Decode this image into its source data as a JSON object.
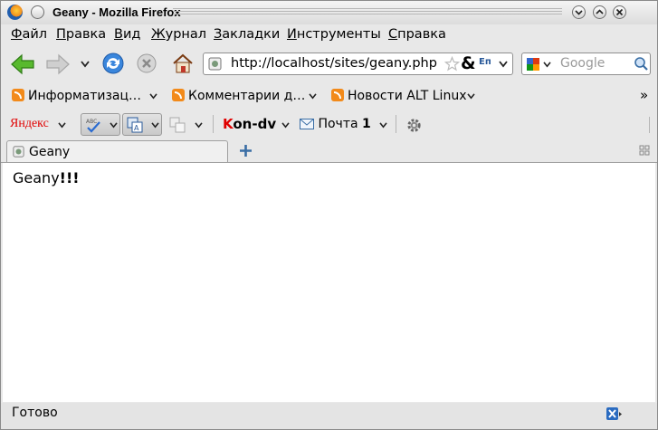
{
  "window": {
    "title": "Geany - Mozilla Firefox"
  },
  "menubar": {
    "items": [
      {
        "label": "Файл",
        "u": "Ф",
        "rest": "айл"
      },
      {
        "label": "Правка",
        "u": "П",
        "rest": "равка"
      },
      {
        "label": "Вид",
        "u": "В",
        "rest": "ид"
      },
      {
        "label": "Журнал",
        "u": "Ж",
        "rest": "урнал"
      },
      {
        "label": "Закладки",
        "u": "З",
        "rest": "акладки"
      },
      {
        "label": "Инструменты",
        "u": "И",
        "rest": "нструменты"
      },
      {
        "label": "Справка",
        "u": "С",
        "rest": "правка"
      }
    ]
  },
  "nav": {
    "url": "http://localhost/sites/geany.php",
    "search_placeholder": "Google",
    "back_icon": "back-arrow-icon",
    "forward_icon": "forward-arrow-icon",
    "reload_icon": "reload-icon",
    "stop_icon": "stop-icon",
    "home_icon": "home-icon"
  },
  "bookmarks": {
    "items": [
      {
        "label": "Информатизац…"
      },
      {
        "label": "Комментарии д…"
      },
      {
        "label": "Новости ALT Linux"
      }
    ],
    "overflow": "»"
  },
  "yandex": {
    "logo": "Яндекс",
    "kon_prefix": "K",
    "kon_rest": "on-dv",
    "mail_label": "Почта",
    "mail_count": "1"
  },
  "tabs": [
    {
      "label": "Geany"
    }
  ],
  "content": {
    "text_a": "Geany",
    "text_b": "!!!"
  },
  "status": {
    "text": "Готово"
  },
  "colors": {
    "back_arrow": "#4caf25",
    "reload": "#2d7ad6",
    "yandex_red": "#e00000",
    "rss": "#f28a1a"
  }
}
